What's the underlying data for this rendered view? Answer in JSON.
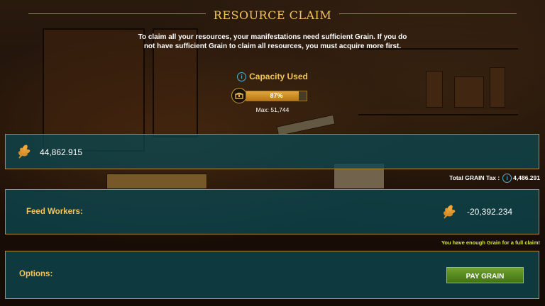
{
  "header": {
    "title": "RESOURCE CLAIM"
  },
  "intro": {
    "text": "To claim all your resources, your manifestations need sufficient Grain. If you do not have sufficient Grain to claim all resources, you must acquire more first."
  },
  "capacity": {
    "label": "Capacity Used",
    "percent_label": "87%",
    "fill_fraction": 0.87,
    "max_label": "Max: 51,744"
  },
  "grain": {
    "amount": "44,862.915"
  },
  "tax": {
    "label": "Total GRAIN Tax :",
    "value": "4,486.291"
  },
  "feed": {
    "label": "Feed Workers:",
    "value": "-20,392.234"
  },
  "status": {
    "message": "You have enough Grain for a full claim!"
  },
  "options": {
    "label": "Options:",
    "button_label": "PAY GRAIN"
  },
  "colors": {
    "accent": "#f2c35a",
    "panel": "#0c4650",
    "border": "#b5893c",
    "button": "#5a8f22",
    "message": "#d8e83a"
  },
  "icons": {
    "info": "info-icon",
    "chest": "chest-icon",
    "grain": "wheat-icon"
  }
}
